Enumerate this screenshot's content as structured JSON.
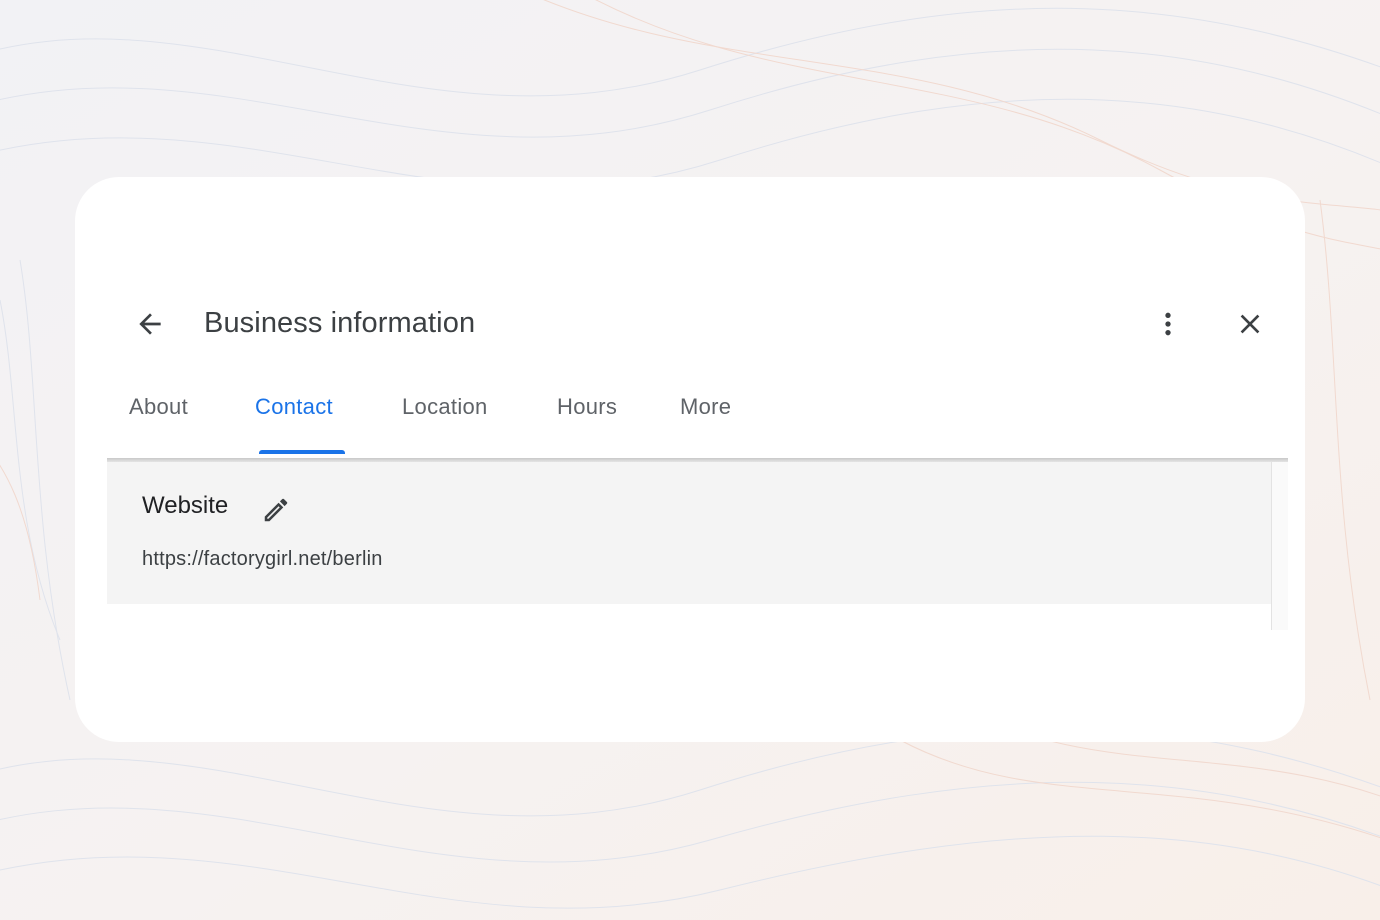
{
  "dialog": {
    "title": "Business information",
    "back_icon": "arrow-back-icon",
    "more_icon": "more-vert-icon",
    "close_icon": "close-icon"
  },
  "tabs": [
    {
      "label": "About",
      "active": false
    },
    {
      "label": "Contact",
      "active": true
    },
    {
      "label": "Location",
      "active": false
    },
    {
      "label": "Hours",
      "active": false
    },
    {
      "label": "More",
      "active": false
    }
  ],
  "contact": {
    "website": {
      "heading": "Website",
      "edit_icon": "pencil-icon",
      "value": "https://factorygirl.net/berlin"
    }
  },
  "colors": {
    "accent": "#1a73e8",
    "title_text": "#3c4043",
    "tab_text": "#5f6368",
    "panel_bg": "#f4f4f4",
    "card_bg": "#ffffff"
  }
}
